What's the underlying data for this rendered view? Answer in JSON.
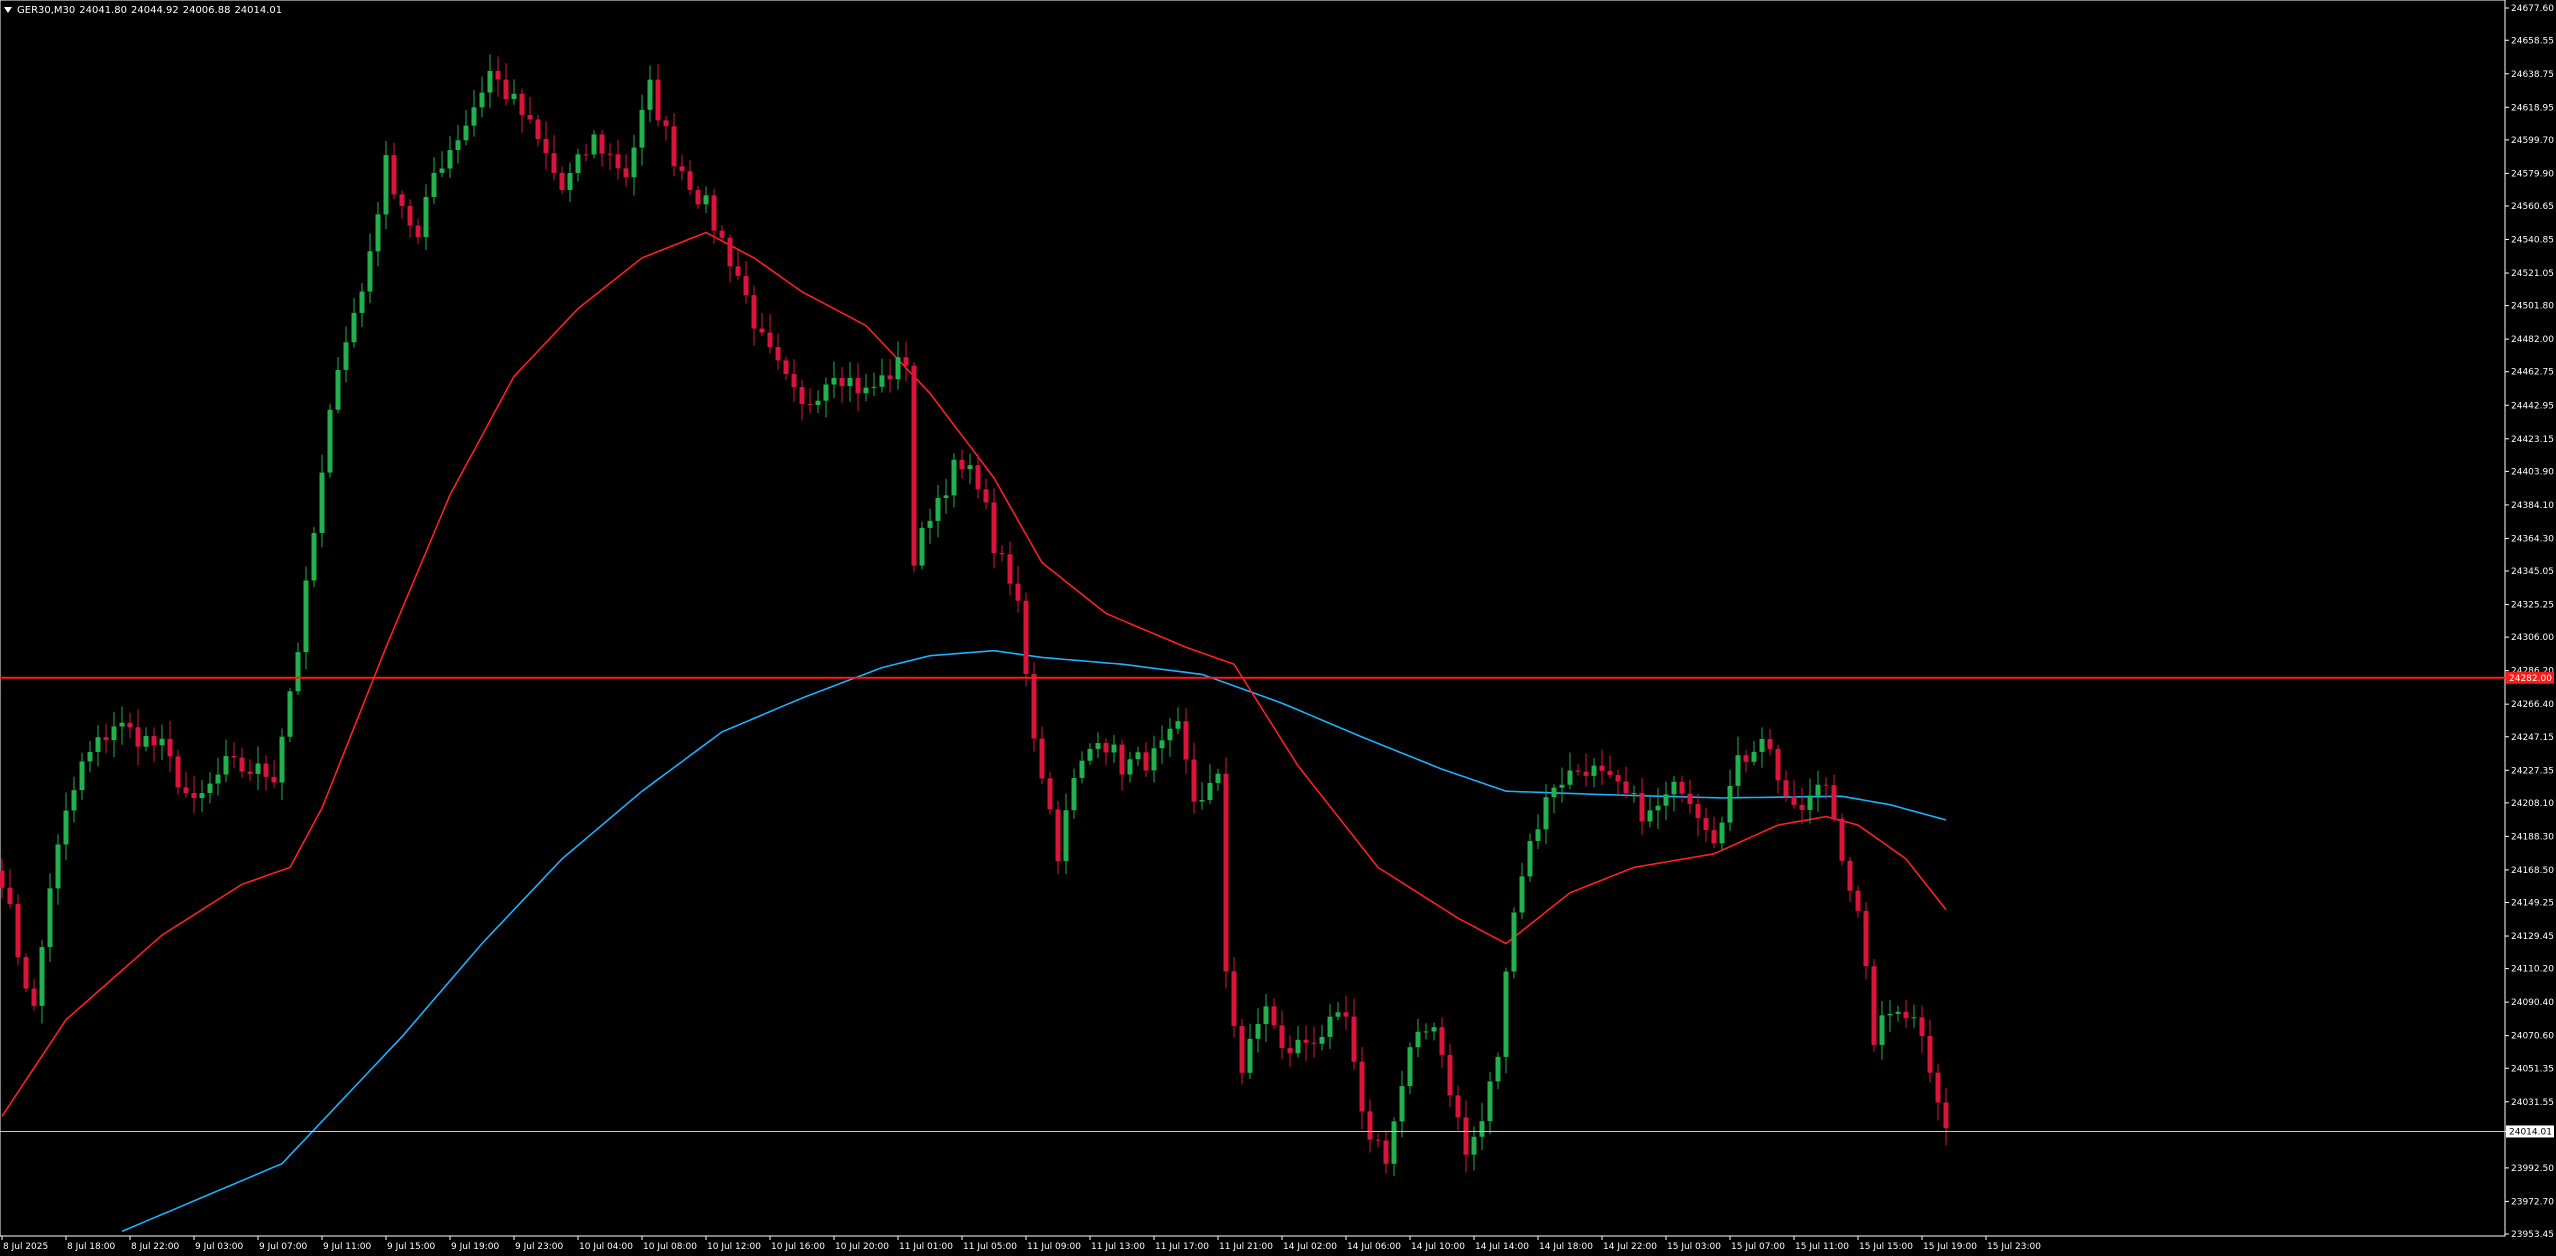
{
  "symbol": "GER30,M30",
  "ohlc": {
    "open": "24041.80",
    "high": "24044.92",
    "low": "24006.88",
    "close": "24014.01"
  },
  "colors": {
    "background": "#000000",
    "bull": "#22b14c",
    "bear": "#dc143c",
    "ma_fast": "#ff2020",
    "ma_slow": "#1ab2ff",
    "hline": "#ff1a1a",
    "bid_line": "#c8c8c8",
    "axis": "#ffffff"
  },
  "chart_data": {
    "type": "candlestick",
    "ylim": [
      23953.45,
      24677.6
    ],
    "y_ticks": [
      "24677.60",
      "24658.55",
      "24638.75",
      "24618.95",
      "24599.70",
      "24579.90",
      "24560.65",
      "24540.85",
      "24521.05",
      "24501.80",
      "24482.00",
      "24462.75",
      "24442.95",
      "24423.15",
      "24403.90",
      "24384.10",
      "24364.30",
      "24345.05",
      "24325.25",
      "24306.00",
      "24286.20",
      "24266.40",
      "24247.15",
      "24227.35",
      "24208.10",
      "24188.30",
      "24168.50",
      "24149.25",
      "24129.45",
      "24110.20",
      "24090.40",
      "24070.60",
      "24051.35",
      "24031.55",
      "24014.01",
      "23992.50",
      "23972.70",
      "23953.45"
    ],
    "x_labels": [
      "8 Jul 2025",
      "8 Jul 18:00",
      "8 Jul 22:00",
      "9 Jul 03:00",
      "9 Jul 07:00",
      "9 Jul 11:00",
      "9 Jul 15:00",
      "9 Jul 19:00",
      "9 Jul 23:00",
      "10 Jul 04:00",
      "10 Jul 08:00",
      "10 Jul 12:00",
      "10 Jul 16:00",
      "10 Jul 20:00",
      "11 Jul 01:00",
      "11 Jul 05:00",
      "11 Jul 09:00",
      "11 Jul 13:00",
      "11 Jul 17:00",
      "11 Jul 21:00",
      "14 Jul 02:00",
      "14 Jul 06:00",
      "14 Jul 10:00",
      "14 Jul 14:00",
      "14 Jul 18:00",
      "14 Jul 22:00",
      "15 Jul 03:00",
      "15 Jul 07:00",
      "15 Jul 11:00",
      "15 Jul 15:00",
      "15 Jul 19:00",
      "15 Jul 23:00"
    ],
    "horizontal_line": {
      "value": 24282,
      "label": "24282.00"
    },
    "current_price": {
      "value": 24014.01,
      "label": "24014.01"
    },
    "anchors": {
      "close": [
        [
          0,
          24165
        ],
        [
          2,
          24120
        ],
        [
          4,
          24085
        ],
        [
          6,
          24160
        ],
        [
          8,
          24200
        ],
        [
          10,
          24230
        ],
        [
          14,
          24255
        ],
        [
          20,
          24240
        ],
        [
          24,
          24205
        ],
        [
          28,
          24230
        ],
        [
          34,
          24225
        ],
        [
          37,
          24300
        ],
        [
          40,
          24400
        ],
        [
          42,
          24470
        ],
        [
          45,
          24510
        ],
        [
          48,
          24585
        ],
        [
          52,
          24540
        ],
        [
          54,
          24580
        ],
        [
          58,
          24610
        ],
        [
          61,
          24640
        ],
        [
          65,
          24615
        ],
        [
          68,
          24590
        ],
        [
          70,
          24570
        ],
        [
          74,
          24600
        ],
        [
          78,
          24580
        ],
        [
          81,
          24630
        ],
        [
          84,
          24590
        ],
        [
          88,
          24560
        ],
        [
          92,
          24520
        ],
        [
          95,
          24480
        ],
        [
          100,
          24440
        ],
        [
          104,
          24465
        ],
        [
          108,
          24450
        ],
        [
          113,
          24470
        ],
        [
          114,
          24350
        ],
        [
          116,
          24380
        ],
        [
          119,
          24405
        ],
        [
          122,
          24400
        ],
        [
          124,
          24360
        ],
        [
          127,
          24325
        ],
        [
          129,
          24250
        ],
        [
          132,
          24180
        ],
        [
          134,
          24220
        ],
        [
          137,
          24250
        ],
        [
          140,
          24230
        ],
        [
          144,
          24235
        ],
        [
          147,
          24250
        ],
        [
          149,
          24210
        ],
        [
          152,
          24220
        ],
        [
          153,
          24110
        ],
        [
          155,
          24050
        ],
        [
          158,
          24090
        ],
        [
          160,
          24060
        ],
        [
          164,
          24070
        ],
        [
          168,
          24080
        ],
        [
          170,
          24020
        ],
        [
          173,
          24000
        ],
        [
          176,
          24060
        ],
        [
          179,
          24080
        ],
        [
          181,
          24040
        ],
        [
          183,
          24000
        ],
        [
          185,
          24020
        ],
        [
          187,
          24060
        ],
        [
          189,
          24150
        ],
        [
          191,
          24185
        ],
        [
          194,
          24220
        ],
        [
          198,
          24230
        ],
        [
          202,
          24215
        ],
        [
          206,
          24200
        ],
        [
          210,
          24220
        ],
        [
          214,
          24190
        ],
        [
          217,
          24230
        ],
        [
          220,
          24250
        ],
        [
          224,
          24200
        ],
        [
          228,
          24220
        ],
        [
          232,
          24140
        ],
        [
          234,
          24070
        ],
        [
          237,
          24090
        ],
        [
          240,
          24075
        ],
        [
          243,
          24014
        ]
      ],
      "ma_fast": [
        [
          0,
          24023
        ],
        [
          8,
          24080
        ],
        [
          20,
          24130
        ],
        [
          30,
          24160
        ],
        [
          36,
          24170
        ],
        [
          40,
          24205
        ],
        [
          48,
          24300
        ],
        [
          56,
          24390
        ],
        [
          64,
          24460
        ],
        [
          72,
          24500
        ],
        [
          80,
          24530
        ],
        [
          88,
          24545
        ],
        [
          94,
          24530
        ],
        [
          100,
          24510
        ],
        [
          108,
          24490
        ],
        [
          116,
          24450
        ],
        [
          124,
          24400
        ],
        [
          130,
          24350
        ],
        [
          138,
          24320
        ],
        [
          148,
          24300
        ],
        [
          154,
          24290
        ],
        [
          162,
          24230
        ],
        [
          172,
          24170
        ],
        [
          182,
          24140
        ],
        [
          188,
          24125
        ],
        [
          196,
          24155
        ],
        [
          204,
          24170
        ],
        [
          214,
          24178
        ],
        [
          222,
          24195
        ],
        [
          228,
          24200
        ],
        [
          232,
          24195
        ],
        [
          238,
          24175
        ],
        [
          243,
          24145
        ]
      ],
      "ma_slow": [
        [
          15,
          23955
        ],
        [
          25,
          23975
        ],
        [
          35,
          23995
        ],
        [
          40,
          24020
        ],
        [
          50,
          24070
        ],
        [
          60,
          24125
        ],
        [
          70,
          24175
        ],
        [
          80,
          24215
        ],
        [
          90,
          24250
        ],
        [
          100,
          24270
        ],
        [
          110,
          24288
        ],
        [
          116,
          24295
        ],
        [
          124,
          24298
        ],
        [
          130,
          24294
        ],
        [
          140,
          24290
        ],
        [
          150,
          24284
        ],
        [
          160,
          24267
        ],
        [
          170,
          24247
        ],
        [
          180,
          24228
        ],
        [
          188,
          24215
        ],
        [
          200,
          24213
        ],
        [
          215,
          24211
        ],
        [
          230,
          24212
        ],
        [
          236,
          24207
        ],
        [
          243,
          24198
        ]
      ]
    }
  }
}
